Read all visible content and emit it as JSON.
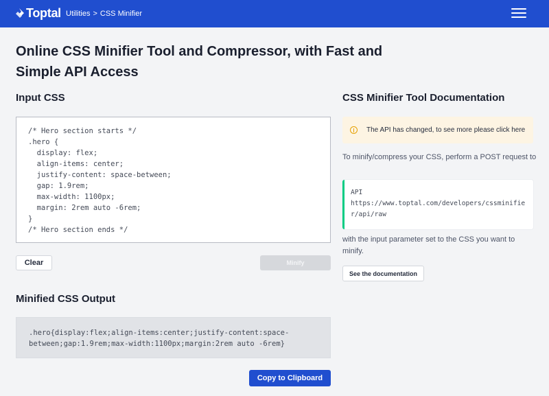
{
  "header": {
    "logo_text": "Toptal",
    "breadcrumb": [
      "Utilities",
      "CSS Minifier"
    ],
    "breadcrumb_sep": ">",
    "menu_icon": "hamburger-menu-icon",
    "bg_color": "#204ecf"
  },
  "page_title": "Online CSS Minifier Tool and Compressor, with Fast and Simple API Access",
  "input": {
    "label": "Input CSS",
    "value": "/* Hero section starts */\n.hero {\n  display: flex;\n  align-items: center;\n  justify-content: space-between;\n  gap: 1.9rem;\n  max-width: 1100px;\n  margin: 2rem auto -6rem;\n}\n/* Hero section ends */",
    "clear_label": "Clear",
    "minify_label": "Minify"
  },
  "output": {
    "label": "Minified CSS Output",
    "value": ".hero{display:flex;align-items:center;justify-content:space-between;gap:1.9rem;max-width:1100px;margin:2rem auto -6rem}",
    "copy_label": "Copy to Clipboard"
  },
  "docs": {
    "title": "CSS Minifier Tool Documentation",
    "notice": "The API has changed, to see more please click here",
    "notice_icon": "warning-icon",
    "intro": "To minify/compress your CSS, perform a POST request to",
    "api_label": "API",
    "api_url": "https://www.toptal.com/developers/cssminifier/api/raw",
    "after_text": "with the input parameter set to the CSS you want to minify.",
    "docs_button": "See the documentation"
  }
}
